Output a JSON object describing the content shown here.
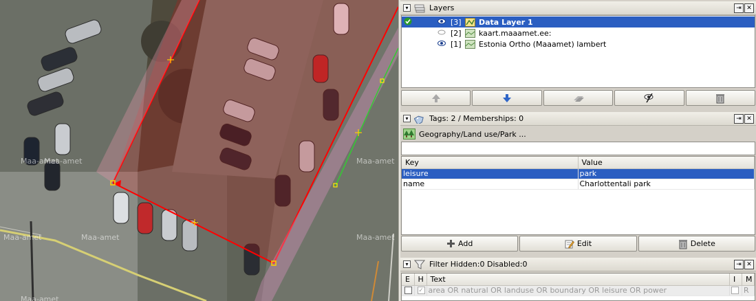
{
  "map": {
    "watermarks": [
      "Maa-amet",
      "Maa-amet",
      "Maa-amet",
      "Maa-amet",
      "Maa-amet",
      "Maa-amet",
      "Maa-amet"
    ]
  },
  "layers_panel": {
    "title": "Layers",
    "layers": [
      {
        "index": "[3]",
        "name": "Data Layer 1",
        "visible": true,
        "active": true,
        "selected": true
      },
      {
        "index": "[2]",
        "name": "kaart.maaamet.ee:",
        "visible": false,
        "active": false,
        "selected": false
      },
      {
        "index": "[1]",
        "name": "Estonia Ortho (Maaamet) lambert",
        "visible": true,
        "active": false,
        "selected": false
      }
    ],
    "buttons": [
      "move-up",
      "move-down",
      "merge",
      "toggle-visibility",
      "delete"
    ]
  },
  "tags_panel": {
    "title": "Tags: 2 / Memberships: 0",
    "preset": "Geography/Land use/Park ...",
    "columns": {
      "key": "Key",
      "value": "Value"
    },
    "rows": [
      {
        "key": "leisure",
        "value": "park",
        "selected": true
      },
      {
        "key": "name",
        "value": "Charlottentali park",
        "selected": false
      }
    ],
    "buttons": {
      "add": "Add",
      "edit": "Edit",
      "delete": "Delete"
    }
  },
  "filter_panel": {
    "title": "Filter Hidden:0 Disabled:0",
    "columns": {
      "e": "E",
      "h": "H",
      "text": "Text",
      "i": "I",
      "m": "M"
    },
    "rows": [
      {
        "text": "area OR natural OR landuse OR boundary OR leisure OR power",
        "enabled": false,
        "hidden": true,
        "m": "R"
      }
    ]
  },
  "colors": {
    "selection": "#2b5ec1",
    "way_selected": "#ff0000",
    "way_other": "#33cc33",
    "panel_bg": "#d4d0c8"
  }
}
